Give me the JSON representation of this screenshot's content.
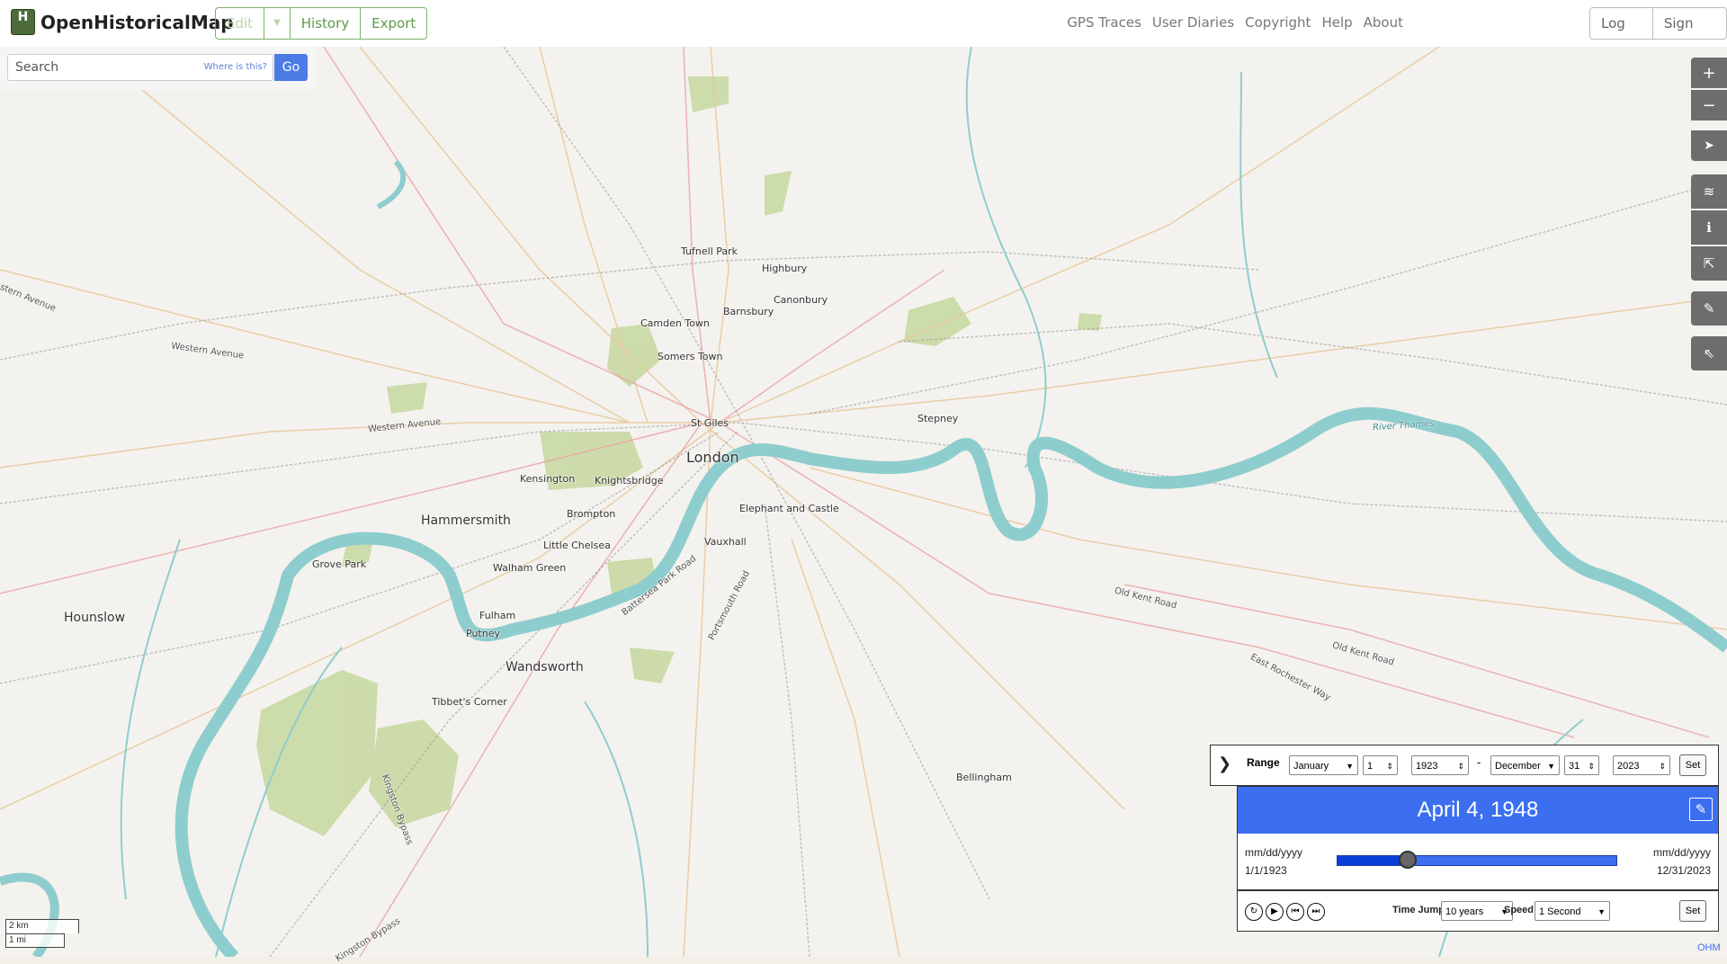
{
  "header": {
    "logo_text": "OpenHistoricalMap",
    "logo_letter": "H",
    "buttons": {
      "edit": "Edit",
      "history": "History",
      "export": "Export"
    },
    "nav": [
      "GPS Traces",
      "User Diaries",
      "Copyright",
      "Help",
      "About"
    ],
    "auth": {
      "login": "Log In",
      "signup": "Sign Up"
    }
  },
  "search": {
    "placeholder": "Search",
    "where": "Where is this?",
    "go": "Go"
  },
  "map_controls": [
    "zoom-in",
    "zoom-out",
    "locate",
    "layers",
    "info",
    "share",
    "note",
    "query"
  ],
  "map_labels": [
    {
      "t": "Tufnell Park"
    },
    {
      "t": "Highbury"
    },
    {
      "t": "Canonbury"
    },
    {
      "t": "Camden Town"
    },
    {
      "t": "Barnsbury"
    },
    {
      "t": "Somers Town"
    },
    {
      "t": "St Giles"
    },
    {
      "t": "Stepney"
    },
    {
      "t": "London"
    },
    {
      "t": "Kensington"
    },
    {
      "t": "Knightsbridge"
    },
    {
      "t": "Brompton"
    },
    {
      "t": "Elephant and Castle"
    },
    {
      "t": "Hammersmith"
    },
    {
      "t": "Little Chelsea"
    },
    {
      "t": "Vauxhall"
    },
    {
      "t": "Grove Park"
    },
    {
      "t": "Walham Green"
    },
    {
      "t": "Fulham"
    },
    {
      "t": "Putney"
    },
    {
      "t": "Hounslow"
    },
    {
      "t": "Wandsworth"
    },
    {
      "t": "Tibbet's Corner"
    },
    {
      "t": "Bellingham"
    },
    {
      "t": "Western Avenue"
    },
    {
      "t": "Western Avenue"
    },
    {
      "t": "stern Avenue"
    },
    {
      "t": "River Thames"
    },
    {
      "t": "Old Kent Road"
    },
    {
      "t": "Old Kent Road"
    },
    {
      "t": "East Rochester Way"
    },
    {
      "t": "Battersea Park Road"
    },
    {
      "t": "Portsmouth Road"
    },
    {
      "t": "Kingston Bypass"
    },
    {
      "t": "Kingston Bypass"
    }
  ],
  "timeslider": {
    "range_label": "Range",
    "start": {
      "month": "January",
      "day": "1",
      "year": "1923"
    },
    "dash": "-",
    "end": {
      "month": "December",
      "day": "31",
      "year": "2023"
    },
    "set": "Set",
    "current_date": "April 4, 1948",
    "left_format": "mm/dd/yyyy",
    "left_date": "1/1/1923",
    "right_format": "mm/dd/yyyy",
    "right_date": "12/31/2023",
    "position_fraction": 0.25,
    "time_jump_label": "Time Jump",
    "time_jump": "10 years",
    "speed_label": "Speed",
    "speed": "1 Second",
    "set2": "Set"
  },
  "scale": {
    "km": "2 km",
    "mi": "1 mi"
  },
  "attribution": "OHM",
  "colors": {
    "accent": "#3b6fef",
    "water": "#8ecdcd",
    "park": "#c8d9a2",
    "edit_green": "#7cb26b"
  }
}
